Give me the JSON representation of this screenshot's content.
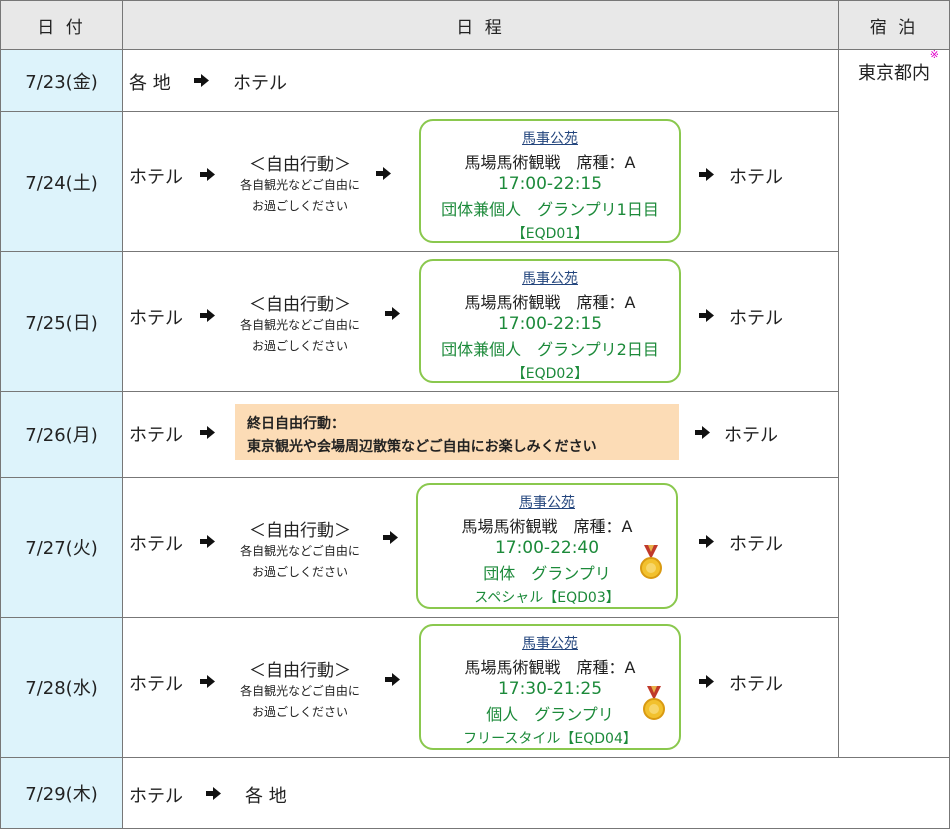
{
  "header": {
    "date": "日 付",
    "schedule": "日 程",
    "stay": "宿 泊"
  },
  "stay": {
    "text": "東京都内",
    "mark": "※"
  },
  "common": {
    "hotel": "ホテル",
    "various": "各 地",
    "free_title": "＜自由行動＞",
    "free_line2": "各自観光などご自由に",
    "free_line3": "お過ごしください",
    "venue": "馬事公苑",
    "seat": "馬場馬術観戦　席種：A"
  },
  "rows": [
    {
      "date": "7/23(金)"
    },
    {
      "date": "7/24(土)",
      "time": "17:00-22:15",
      "event": "団体兼個人　グランプリ1日目",
      "code": "【EQD01】"
    },
    {
      "date": "7/25(日)",
      "time": "17:00-22:15",
      "event": "団体兼個人　グランプリ2日目",
      "code": "【EQD02】"
    },
    {
      "date": "7/26(月)",
      "note1": "終日自由行動：",
      "note2": "東京観光や会場周辺散策などご自由にお楽しみください"
    },
    {
      "date": "7/27(火)",
      "time": "17:00-22:40",
      "event": "団体　グランプリ",
      "code": "スペシャル【EQD03】"
    },
    {
      "date": "7/28(水)",
      "time": "17:30-21:25",
      "event": "個人　グランプリ",
      "code": "フリースタイル【EQD04】"
    },
    {
      "date": "7/29(木)"
    }
  ],
  "icons": {
    "arrow": "right-arrow-icon",
    "medal": "gold-medal-icon"
  },
  "colors": {
    "date_bg": "#ddf3fb",
    "header_bg": "#e8e8e8",
    "box_border": "#8ac84e",
    "event_text": "#1c8a3a",
    "venue_text": "#23457d",
    "note_bg": "#fcdcb6",
    "mark": "#e000c8"
  }
}
